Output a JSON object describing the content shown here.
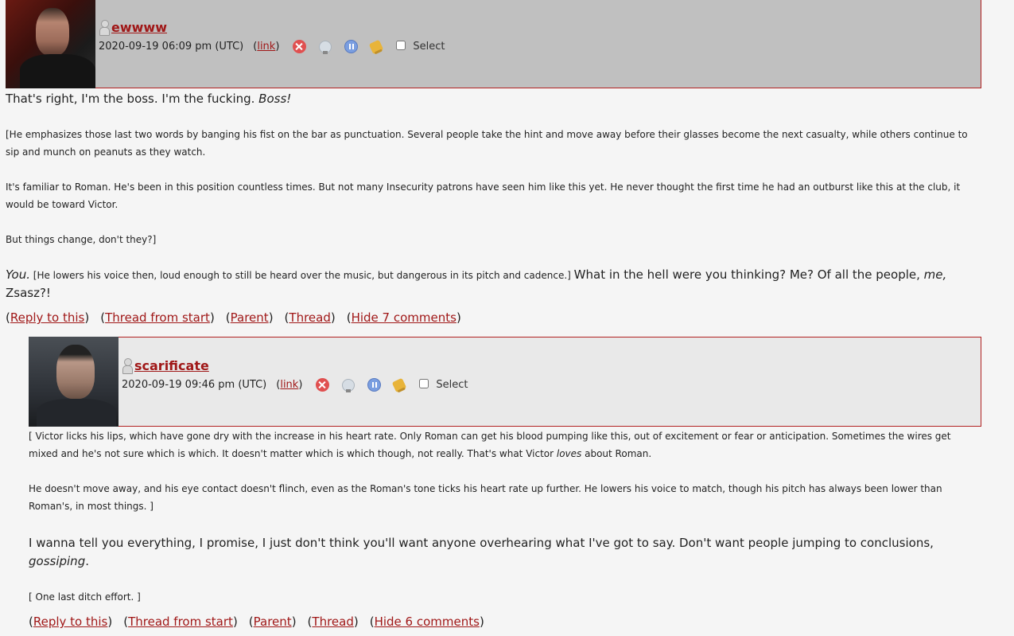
{
  "comments": [
    {
      "username": "ewwww",
      "timestamp": "2020-09-19 06:09 pm (UTC)",
      "link_label": "link",
      "select_label": "Select",
      "icons": [
        "delete-icon",
        "screen-icon",
        "freeze-icon",
        "track-icon"
      ],
      "body": {
        "line1_a": "That's right, I'm the boss. I'm the fucking. ",
        "line1_b": "Boss!",
        "p2": "[He emphasizes those last two words by banging his fist on the bar as punctuation. Several people take the hint and move away before their glasses become the next casualty, while others continue to sip and munch on peanuts as they watch.",
        "p3": "It's familiar to Roman. He's been in this position countless times. But not many Insecurity patrons have seen him like this yet. He never thought the first time he had an outburst like this at the club, it would be toward Victor.",
        "p4": "But things change, don't they?]",
        "p5_a": "You.",
        "p5_b": " [He lowers his voice then, loud enough to still be heard over the music, but dangerous in its pitch and cadence.] ",
        "p5_c": "What in the hell were you thinking? Me? Of all the people, ",
        "p5_d": "me,",
        "p5_e": "Zsasz?!"
      },
      "actions": {
        "reply": "Reply to this",
        "thread_from_start": "Thread from start",
        "parent": "Parent",
        "thread": "Thread",
        "hide": "Hide 7 comments"
      }
    },
    {
      "username": "scarificate",
      "timestamp": "2020-09-19 09:46 pm (UTC)",
      "link_label": "link",
      "select_label": "Select",
      "icons": [
        "delete-icon",
        "screen-icon",
        "freeze-icon",
        "track-icon"
      ],
      "body": {
        "p1_a": "[ Victor licks his lips, which have gone dry with the increase in his heart rate. Only Roman can get his blood pumping like this, out of excitement or fear or anticipation. Sometimes the wires get mixed and he's not sure which is which. It doesn't matter which is which though, not really. That's what Victor ",
        "p1_b": "loves",
        "p1_c": " about Roman.",
        "p2": "He doesn't move away, and his eye contact doesn't flinch, even as the Roman's tone ticks his heart rate up further. He lowers his voice to match, though his pitch has always been lower than Roman's, in most things. ]",
        "p3_a": "I wanna tell you everything, I promise, I just don't think you'll want anyone overhearing what I've got to say. Don't want people jumping to conclusions, ",
        "p3_b": "gossiping",
        "p3_c": ".",
        "p4": "[ One last ditch effort. ]"
      },
      "actions": {
        "reply": "Reply to this",
        "thread_from_start": "Thread from start",
        "parent": "Parent",
        "thread": "Thread",
        "hide": "Hide 6 comments"
      }
    }
  ]
}
